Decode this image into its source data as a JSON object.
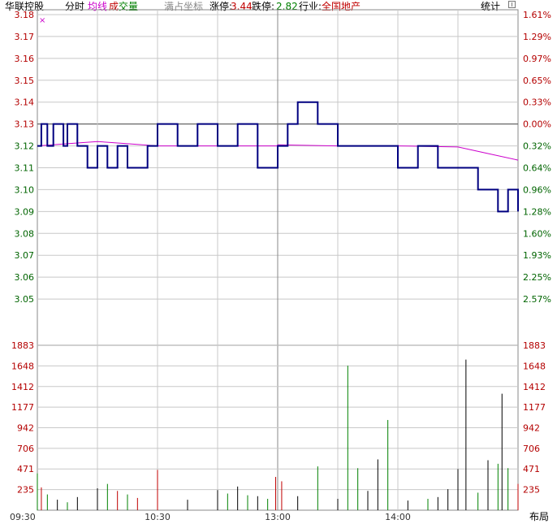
{
  "header": {
    "stock_name": "华联控股",
    "period_label": "分时",
    "avg_label": "均线",
    "volume_label_a": "成",
    "volume_label_b": "交量",
    "full_coord_label": "满占坐标",
    "limit_up_label": "涨停:",
    "limit_up_value": "3.44",
    "limit_down_label": "跌停:",
    "limit_down_value": "2.82",
    "industry_label": "行业:",
    "industry_value": "全国地产",
    "stats_label": "统计"
  },
  "layout_button_label": "布局",
  "colors": {
    "price_line": "#000080",
    "avg_line": "#cc00cc",
    "grid": "#c8c8c8",
    "axis_green": "#006400",
    "axis_red": "#b40000",
    "vol_up": "#c00000",
    "vol_down": "#008000",
    "vol_flat": "#000000"
  },
  "chart_data": {
    "type": "line",
    "title": "华联控股 分时",
    "prev_close": 3.13,
    "price_axis": {
      "ylim": [
        3.04,
        3.18
      ],
      "left_ticks": [
        "3.18",
        "3.17",
        "3.16",
        "3.15",
        "3.14",
        "3.13",
        "3.12",
        "3.11",
        "3.10",
        "3.09",
        "3.08",
        "3.07",
        "3.06",
        "3.05"
      ],
      "right_ticks": [
        "1.61%",
        "1.29%",
        "0.97%",
        "0.65%",
        "0.33%",
        "0.00%",
        "0.32%",
        "0.64%",
        "0.96%",
        "1.28%",
        "1.60%",
        "1.93%",
        "2.25%",
        "2.57%"
      ]
    },
    "time_axis": {
      "ticks": [
        "09:30",
        "10:30",
        "13:00",
        "14:00"
      ]
    },
    "series": [
      {
        "name": "分时",
        "x": [
          "09:30",
          "09:32",
          "09:35",
          "09:38",
          "09:40",
          "09:43",
          "09:45",
          "09:50",
          "09:55",
          "10:00",
          "10:05",
          "10:10",
          "10:15",
          "10:20",
          "10:25",
          "10:30",
          "10:40",
          "10:50",
          "11:00",
          "11:10",
          "11:20",
          "11:30",
          "13:05",
          "13:10",
          "13:15",
          "13:20",
          "13:30",
          "13:40",
          "13:50",
          "14:00",
          "14:10",
          "14:20",
          "14:30",
          "14:40",
          "14:45",
          "14:50",
          "14:55",
          "15:00"
        ],
        "values": [
          3.12,
          3.13,
          3.12,
          3.13,
          3.13,
          3.12,
          3.13,
          3.12,
          3.11,
          3.12,
          3.11,
          3.12,
          3.11,
          3.11,
          3.12,
          3.13,
          3.12,
          3.13,
          3.12,
          3.13,
          3.11,
          3.12,
          3.13,
          3.14,
          3.14,
          3.13,
          3.12,
          3.12,
          3.12,
          3.11,
          3.12,
          3.11,
          3.11,
          3.1,
          3.1,
          3.09,
          3.1,
          3.09
        ]
      },
      {
        "name": "均线",
        "x": [
          "09:30",
          "09:45",
          "10:00",
          "10:15",
          "10:30",
          "11:00",
          "11:30",
          "13:00",
          "13:30",
          "14:00",
          "14:30",
          "14:45",
          "15:00"
        ],
        "values": [
          3.12,
          3.121,
          3.122,
          3.121,
          3.12,
          3.12,
          3.12,
          3.1205,
          3.12,
          3.12,
          3.1195,
          3.1165,
          3.1135
        ]
      }
    ],
    "volume_axis": {
      "ylim": [
        0,
        1883
      ],
      "ticks": [
        "1883",
        "1648",
        "1412",
        "1177",
        "942",
        "706",
        "471",
        "235"
      ]
    },
    "volume": [
      {
        "time": "09:30",
        "value": 420,
        "dir": "down"
      },
      {
        "time": "09:32",
        "value": 260,
        "dir": "up"
      },
      {
        "time": "09:35",
        "value": 180,
        "dir": "down"
      },
      {
        "time": "09:40",
        "value": 120,
        "dir": "flat"
      },
      {
        "time": "09:45",
        "value": 90,
        "dir": "down"
      },
      {
        "time": "09:50",
        "value": 150,
        "dir": "flat"
      },
      {
        "time": "10:00",
        "value": 250,
        "dir": "flat"
      },
      {
        "time": "10:05",
        "value": 300,
        "dir": "down"
      },
      {
        "time": "10:10",
        "value": 220,
        "dir": "up"
      },
      {
        "time": "10:15",
        "value": 180,
        "dir": "down"
      },
      {
        "time": "10:20",
        "value": 140,
        "dir": "up"
      },
      {
        "time": "10:30",
        "value": 460,
        "dir": "up"
      },
      {
        "time": "10:45",
        "value": 120,
        "dir": "flat"
      },
      {
        "time": "11:00",
        "value": 230,
        "dir": "flat"
      },
      {
        "time": "11:05",
        "value": 190,
        "dir": "down"
      },
      {
        "time": "11:10",
        "value": 270,
        "dir": "flat"
      },
      {
        "time": "11:15",
        "value": 170,
        "dir": "down"
      },
      {
        "time": "11:20",
        "value": 160,
        "dir": "flat"
      },
      {
        "time": "11:25",
        "value": 130,
        "dir": "down"
      },
      {
        "time": "11:29",
        "value": 380,
        "dir": "up"
      },
      {
        "time": "13:02",
        "value": 330,
        "dir": "up"
      },
      {
        "time": "13:10",
        "value": 160,
        "dir": "flat"
      },
      {
        "time": "13:20",
        "value": 500,
        "dir": "down"
      },
      {
        "time": "13:30",
        "value": 130,
        "dir": "flat"
      },
      {
        "time": "13:35",
        "value": 1650,
        "dir": "down"
      },
      {
        "time": "13:40",
        "value": 480,
        "dir": "down"
      },
      {
        "time": "13:45",
        "value": 220,
        "dir": "flat"
      },
      {
        "time": "13:50",
        "value": 580,
        "dir": "flat"
      },
      {
        "time": "13:55",
        "value": 1030,
        "dir": "down"
      },
      {
        "time": "14:05",
        "value": 110,
        "dir": "flat"
      },
      {
        "time": "14:15",
        "value": 130,
        "dir": "down"
      },
      {
        "time": "14:20",
        "value": 150,
        "dir": "flat"
      },
      {
        "time": "14:25",
        "value": 240,
        "dir": "flat"
      },
      {
        "time": "14:30",
        "value": 470,
        "dir": "flat"
      },
      {
        "time": "14:34",
        "value": 1720,
        "dir": "flat"
      },
      {
        "time": "14:40",
        "value": 200,
        "dir": "down"
      },
      {
        "time": "14:45",
        "value": 570,
        "dir": "flat"
      },
      {
        "time": "14:50",
        "value": 530,
        "dir": "down"
      },
      {
        "time": "14:52",
        "value": 1330,
        "dir": "flat"
      },
      {
        "time": "14:55",
        "value": 480,
        "dir": "down"
      },
      {
        "time": "15:00",
        "value": 300,
        "dir": "up"
      }
    ]
  }
}
